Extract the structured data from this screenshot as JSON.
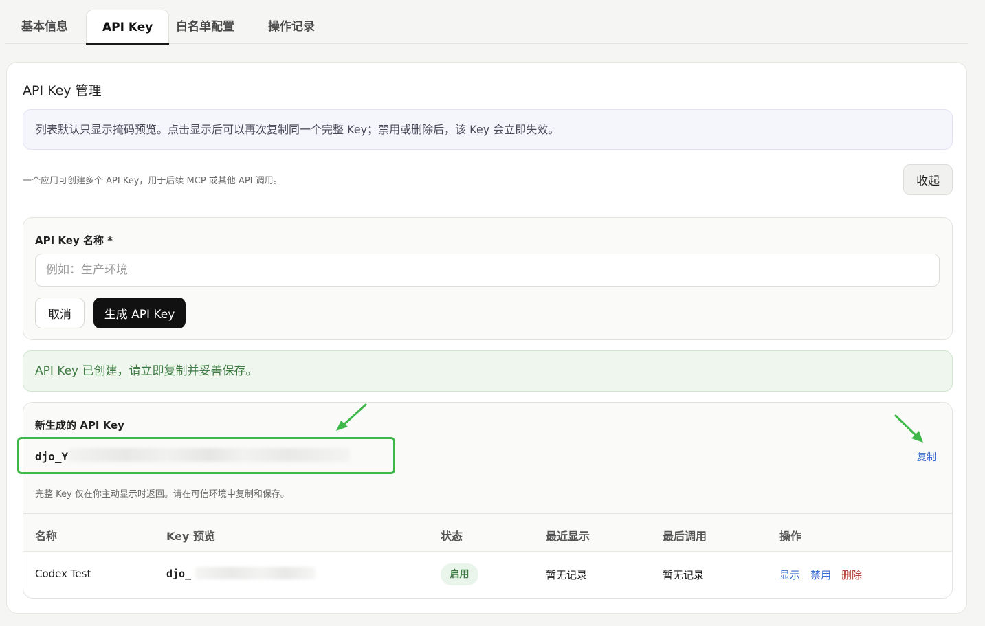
{
  "tabs": [
    {
      "label": "基本信息"
    },
    {
      "label": "API Key"
    },
    {
      "label": "白名单配置"
    },
    {
      "label": "操作记录"
    }
  ],
  "section_title": "API Key 管理",
  "info_banner": "列表默认只显示掩码预览。点击显示后可以再次复制同一个完整 Key；禁用或删除后，该 Key 会立即失效。",
  "description": "一个应用可创建多个 API Key，用于后续 MCP 或其他 API 调用。",
  "collapse_label": "收起",
  "form": {
    "name_label": "API Key 名称 *",
    "name_placeholder": "例如：生产环境",
    "cancel_label": "取消",
    "generate_label": "生成 API Key"
  },
  "success_banner": "API Key 已创建，请立即复制并妥善保存。",
  "new_key": {
    "title": "新生成的 API Key",
    "value": "djo_Y",
    "copy_label": "复制",
    "note": "完整 Key 仅在你主动显示时返回。请在可信环境中复制和保存。"
  },
  "table": {
    "headers": [
      "名称",
      "Key 预览",
      "状态",
      "最近显示",
      "最后调用",
      "操作"
    ],
    "rows": [
      {
        "name": "Codex Test",
        "preview": "djo_",
        "status": "启用",
        "last_shown": "暂无记录",
        "last_called": "暂无记录",
        "actions": {
          "show": "显示",
          "disable": "禁用",
          "delete": "删除"
        }
      }
    ]
  },
  "colors": {
    "accent_link": "#3a6bd0",
    "danger": "#b2403a",
    "success": "#3f7a43",
    "highlight": "#3fb84a"
  }
}
